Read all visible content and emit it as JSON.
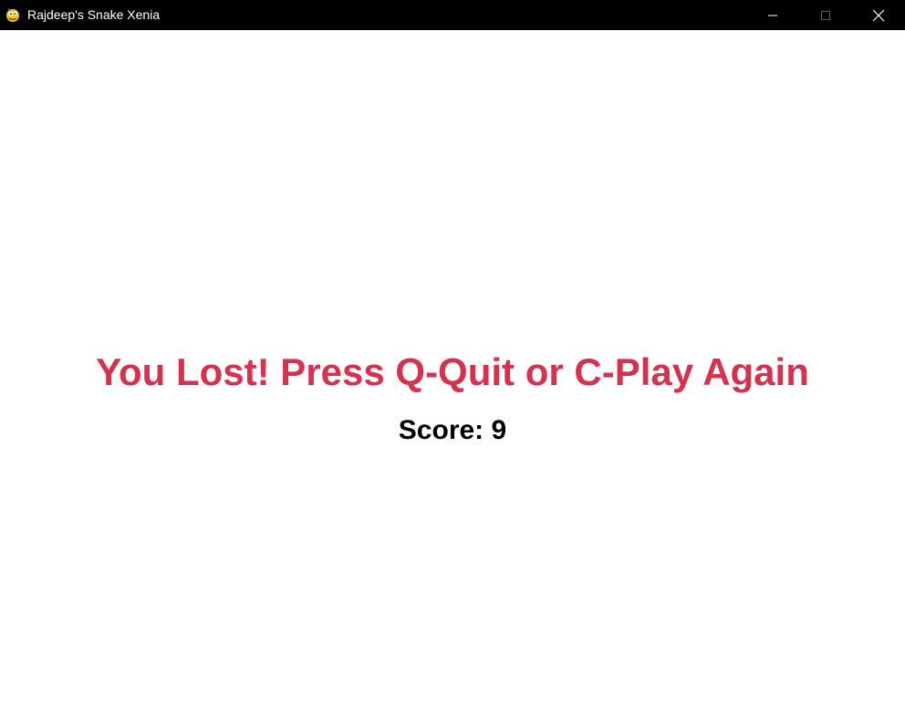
{
  "window": {
    "title": "Rajdeep's Snake Xenia",
    "icon": "pygame-snake-icon",
    "controls": {
      "minimize_icon": "minimize-icon",
      "maximize_icon": "maximize-icon",
      "close_icon": "close-icon"
    }
  },
  "game": {
    "message": "You Lost! Press Q-Quit or C-Play Again",
    "score_text": "Score: 9",
    "score": 9
  },
  "colors": {
    "titlebar": "#000000",
    "background": "#ffffff",
    "message": "#d6314f",
    "score": "#000000"
  }
}
